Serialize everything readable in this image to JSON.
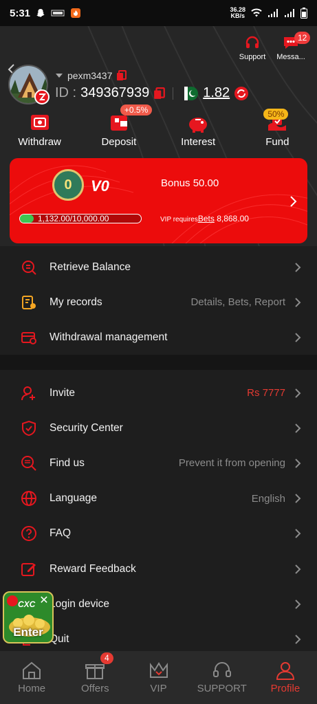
{
  "status_bar": {
    "time": "5:31",
    "network_speed_value": "36.28",
    "network_speed_unit": "KB/s"
  },
  "header": {
    "support_label": "Support",
    "messages_label": "Messa...",
    "messages_count": "12",
    "username": "pexm3437",
    "id_label": "ID :",
    "id_value": "349367939",
    "balance": "1.82"
  },
  "actions": [
    {
      "label": "Withdraw",
      "icon": "withdraw-icon"
    },
    {
      "label": "Deposit",
      "icon": "deposit-icon",
      "tag": "+0.5%"
    },
    {
      "label": "Interest",
      "icon": "piggy-bank-icon"
    },
    {
      "label": "Fund",
      "icon": "fund-icon",
      "tag": "50%"
    }
  ],
  "vip": {
    "coin_level": "0",
    "level": "V0",
    "bonus": "Bonus 50.00",
    "progress_text": "1,132.00/10,000.00",
    "progress_fraction": 0.1132,
    "requires_text": "VIP requires",
    "bets_label": "Bets",
    "bets_value": "8,868.00"
  },
  "menu_top": [
    {
      "label": "Retrieve Balance",
      "value": "",
      "icon": "retrieve-balance-icon"
    },
    {
      "label": "My records",
      "value": "Details, Bets, Report",
      "icon": "records-icon"
    },
    {
      "label": "Withdrawal management",
      "value": "",
      "icon": "withdrawal-management-icon"
    }
  ],
  "menu_bottom": [
    {
      "label": "Invite",
      "value": "Rs 7777",
      "icon": "invite-icon"
    },
    {
      "label": "Security Center",
      "value": "",
      "icon": "shield-icon"
    },
    {
      "label": "Find us",
      "value": "Prevent it from opening",
      "icon": "find-us-icon"
    },
    {
      "label": "Language",
      "value": "English",
      "icon": "globe-icon"
    },
    {
      "label": "FAQ",
      "value": "",
      "icon": "faq-icon"
    },
    {
      "label": "Reward Feedback",
      "value": "",
      "icon": "edit-icon"
    },
    {
      "label": "Login device",
      "value": "",
      "icon": "device-icon"
    },
    {
      "label": "Quit",
      "value": "",
      "icon": "quit-icon"
    }
  ],
  "float_ad": {
    "brand": "CXC",
    "button": "Enter"
  },
  "tabbar": [
    {
      "label": "Home",
      "icon": "home-icon"
    },
    {
      "label": "Offers",
      "icon": "gift-icon",
      "badge": "4"
    },
    {
      "label": "VIP",
      "icon": "crown-icon"
    },
    {
      "label": "SUPPORT",
      "icon": "headset-icon"
    },
    {
      "label": "Profile",
      "icon": "profile-icon",
      "active": true
    }
  ],
  "colors": {
    "accent": "#e53a32",
    "card_red": "#ec0c0c",
    "background": "#1e1e1e",
    "progress_green": "#3cc552"
  }
}
